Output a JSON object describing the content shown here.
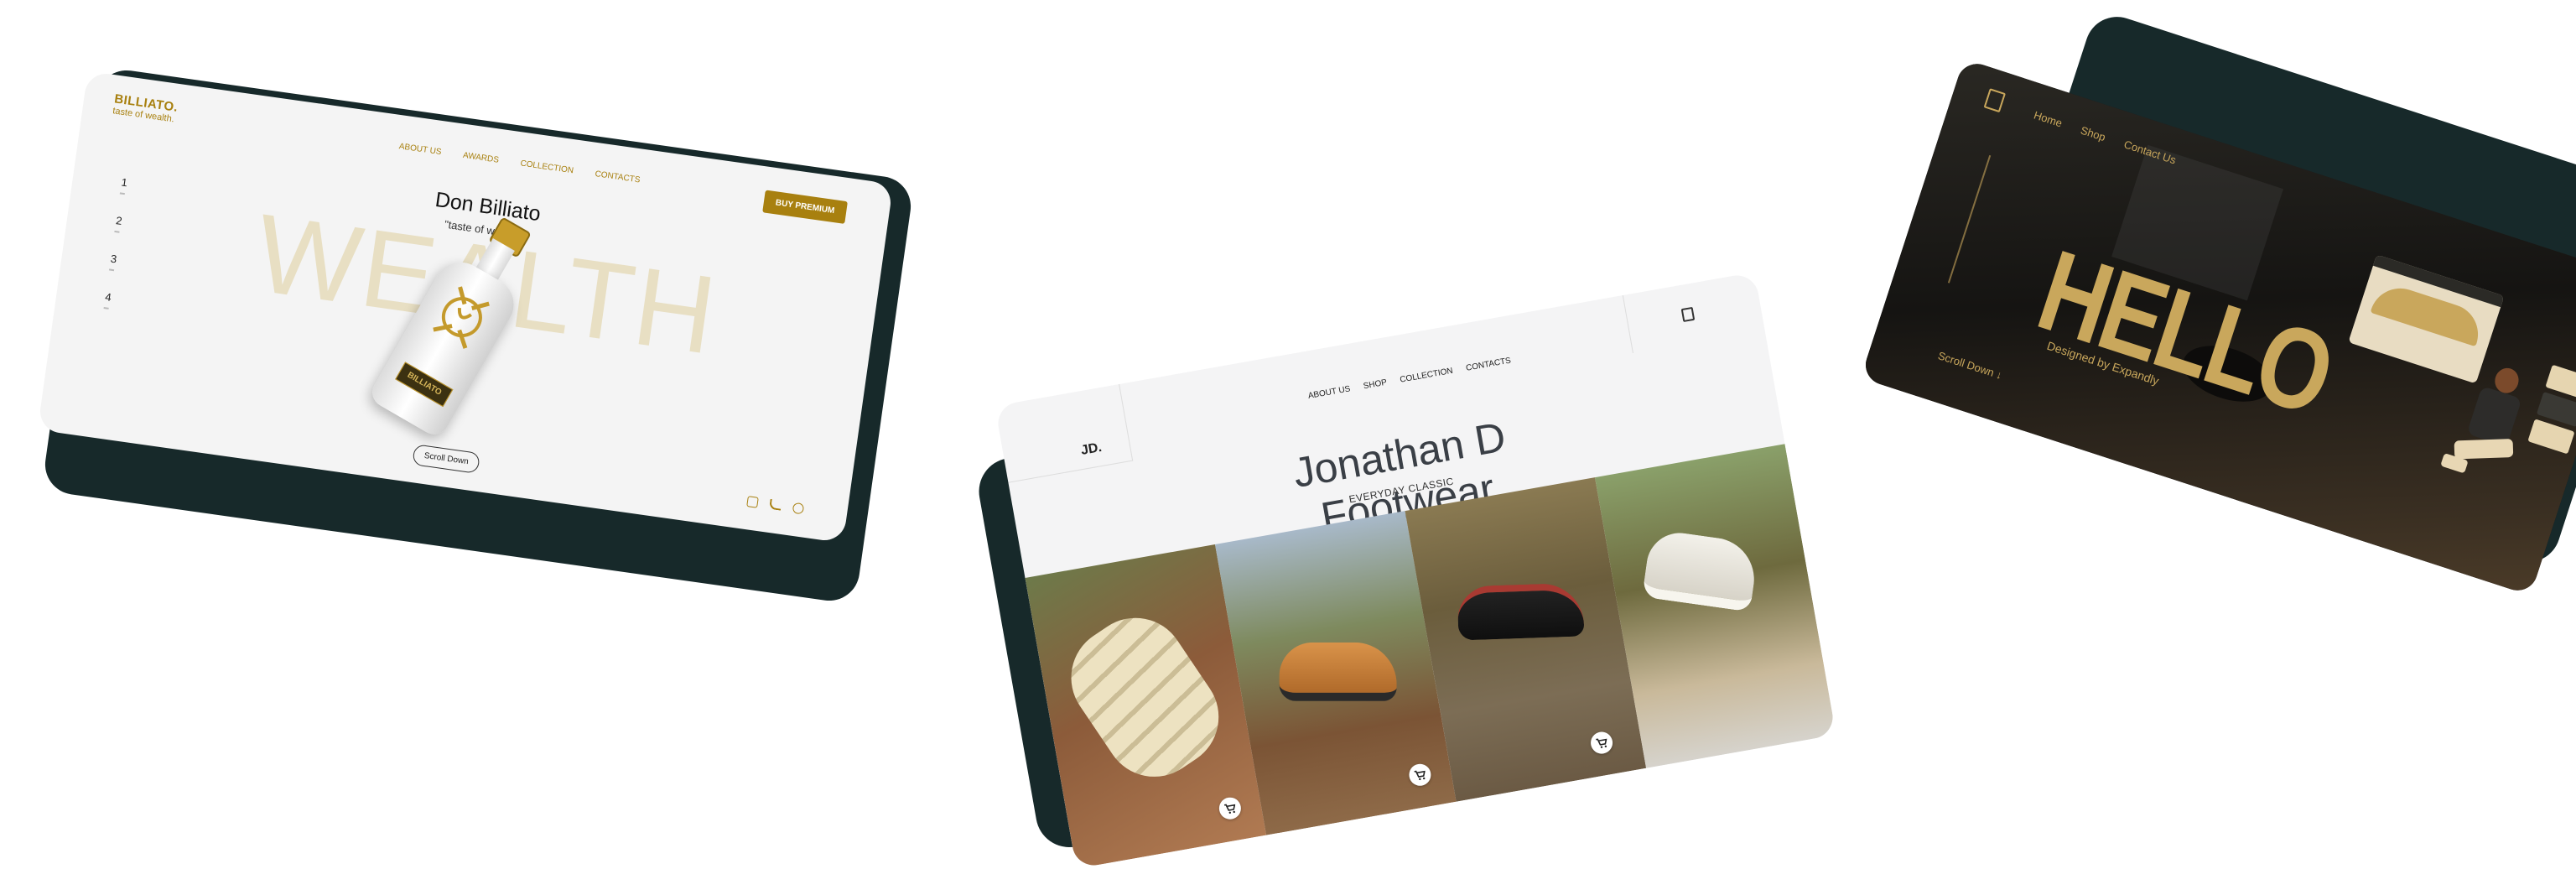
{
  "billiato": {
    "logo_name": "BILLIATO.",
    "logo_tagline": "taste of wealth.",
    "nav": [
      "ABOUT US",
      "AWARDS",
      "COLLECTION",
      "CONTACTS"
    ],
    "cta": "BUY PREMIUM",
    "title": "Don Billiato",
    "subtitle": "\"taste of wealth.\"",
    "background_word": "WEALTH",
    "pager": [
      "1",
      "2",
      "3",
      "4"
    ],
    "scroll_label": "Scroll Down",
    "bottle_label": "BILLIATO",
    "social_icons": [
      "instagram-icon",
      "twitter-icon",
      "whatsapp-icon"
    ],
    "colors": {
      "accent": "#a8800f",
      "watermark": "#e8dfc3"
    }
  },
  "jd": {
    "logo": "JD.",
    "nav": [
      "ABOUT US",
      "SHOP",
      "COLLECTION",
      "CONTACTS"
    ],
    "title": "Jonathan D Footwear",
    "subtitle": "EVERYDAY CLASSIC",
    "icons": [
      "bag-icon",
      "cart-icon"
    ]
  },
  "law": {
    "nav": [
      "Home",
      "Shop",
      "Contact Us"
    ],
    "headline": "HELLO",
    "credit": "Designed by Expandly",
    "scroll_label": "Scroll Down ↓",
    "colors": {
      "accent": "#c9a75c",
      "panel": "#1b1b1b"
    }
  }
}
